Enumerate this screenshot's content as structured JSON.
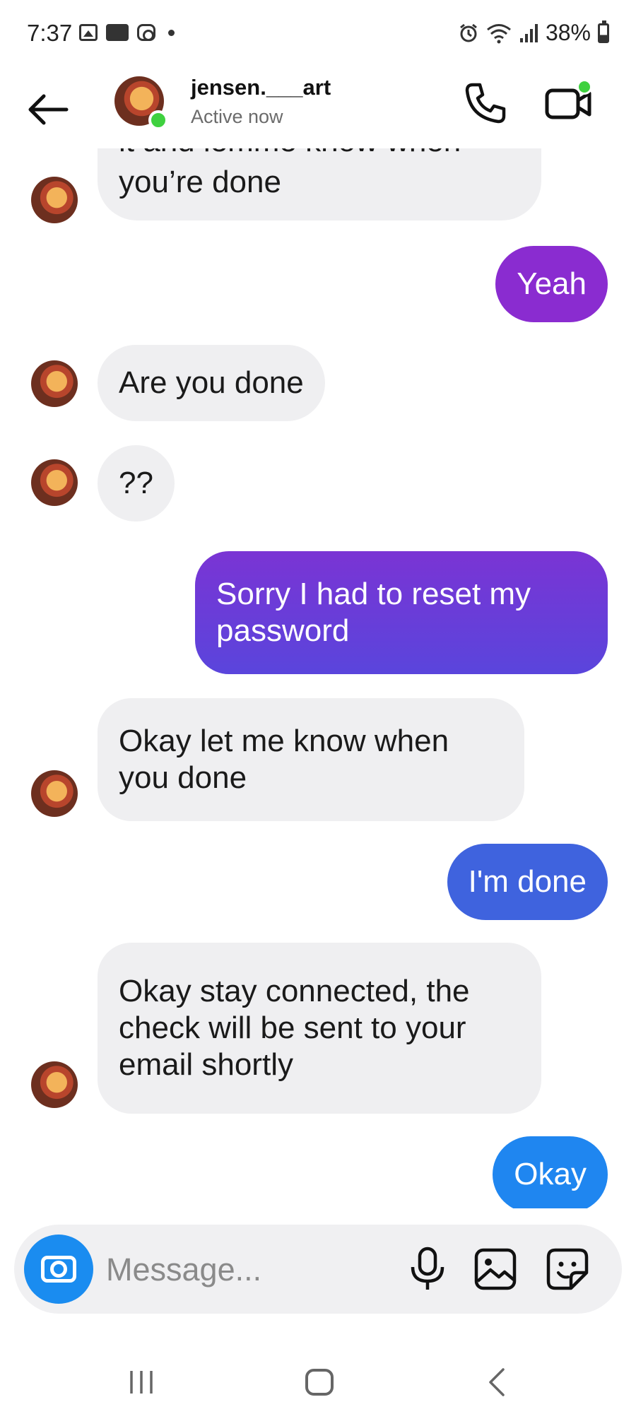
{
  "status_bar": {
    "time": "7:37",
    "battery": "38%",
    "icons": [
      "gallery-icon",
      "voicemail-icon",
      "instagram-icon",
      "dot",
      "alarm-icon",
      "wifi-icon",
      "signal-icon",
      "battery-icon"
    ]
  },
  "header": {
    "username": "jensen.___art",
    "status": "Active now",
    "online_color": "#3fd13f"
  },
  "messages": [
    {
      "side": "in",
      "text": "you’re done",
      "partial_top": "it and lemme know when"
    },
    {
      "side": "out",
      "text": "Yeah",
      "color": "#8a2cd0"
    },
    {
      "side": "in",
      "text": "Are you done"
    },
    {
      "side": "in",
      "text": "??"
    },
    {
      "side": "out",
      "text": "Sorry I had to reset my\npassword",
      "color": "#6a3bd8"
    },
    {
      "side": "in",
      "text": "Okay let me know when\nyou done"
    },
    {
      "side": "out",
      "text": "I'm done",
      "color": "#3f63de"
    },
    {
      "side": "in",
      "text": "Okay stay connected, the\ncheck will be sent to your\nemail shortly"
    },
    {
      "side": "out",
      "text": "Okay",
      "color": "#1f86f0"
    }
  ],
  "composer": {
    "placeholder": "Message...",
    "camera_color": "#1a8cf0"
  },
  "navbar": {
    "buttons": [
      "recent-apps",
      "home",
      "back"
    ]
  }
}
